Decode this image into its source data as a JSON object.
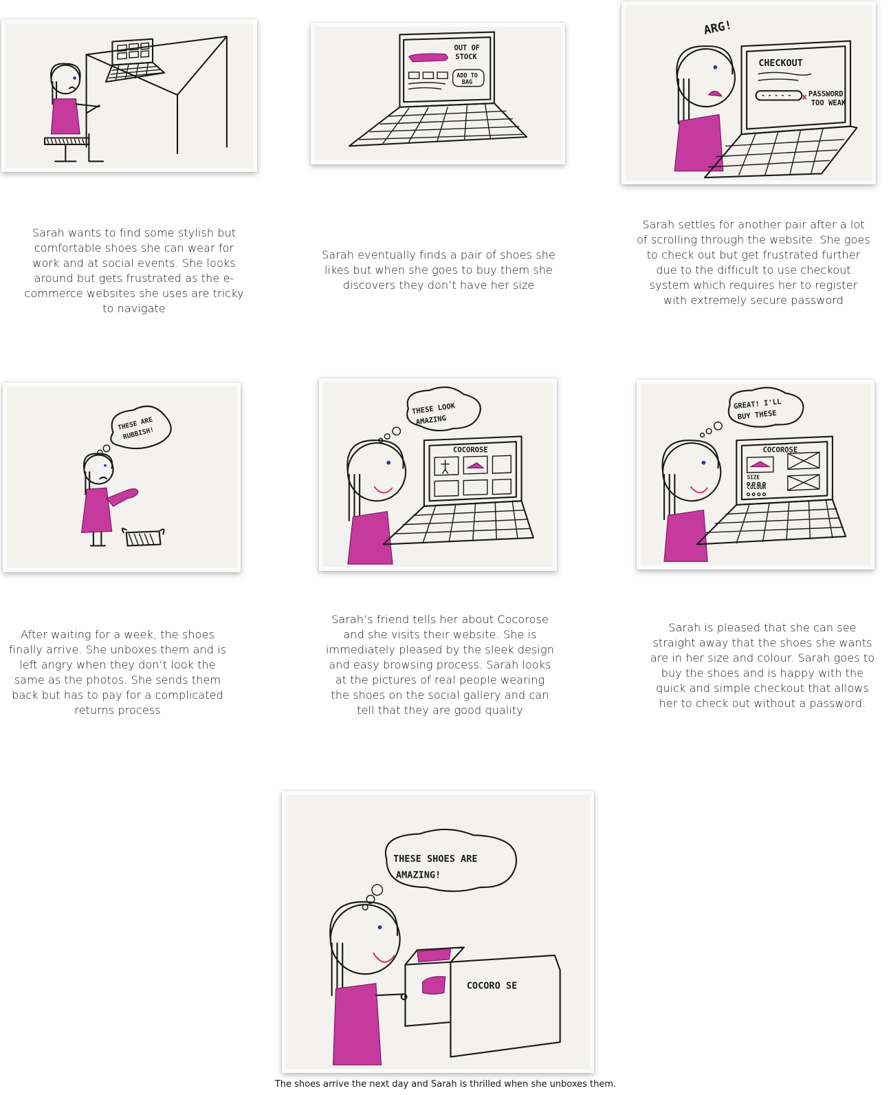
{
  "panels": [
    {
      "caption": "Sarah wants to find some stylish but comfortable shoes she can wear for work and at social events. She looks around but gets frustrated as the e-commerce websites she uses are tricky to navigate"
    },
    {
      "caption": "Sarah eventually finds a pair of shoes she likes but when she goes to buy them she discovers they don’t have her size",
      "screen_text": [
        "OUT OF",
        "STOCK",
        "ADD TO",
        "BAG"
      ]
    },
    {
      "caption": "Sarah settles for another pair after a lot of scrolling through the website. She goes to check out but get frustrated further due to the difficult to use checkout system which requires her to register with extremely secure password",
      "exclaim": "ARG!",
      "screen_title": "CHECKOUT",
      "error_text": [
        "PASSWORD",
        "TOO WEAK"
      ]
    },
    {
      "caption": "After waiting for a week, the shoes finally arrive. She unboxes them and is left angry when they don’t look the same as the photos. She sends them back but has to pay for a complicated returns process",
      "thought": [
        "THESE ARE",
        "RUBBISH!"
      ]
    },
    {
      "caption": "Sarah’s friend tells her about Cocorose and she visits their website. She is immediately pleased by the sleek design and easy browsing process. Sarah looks at the pictures of real people wearing the shoes on the social gallery and can tell that they are good quality",
      "thought": [
        "THESE LOOK",
        "AMAZING"
      ],
      "screen_title": "COCOROSE"
    },
    {
      "caption": "Sarah is pleased that she can see straight away that the shoes she wants are in her size and colour. Sarah goes to buy the shoes and is happy with the quick and simple checkout that allows her to check out without a password.",
      "thought": [
        "GREAT! I'LL",
        "BUY THESE"
      ],
      "screen_title": "COCOROSE",
      "options": [
        "SIZE",
        "COLOUR"
      ]
    },
    {
      "caption": "The shoes arrive the next day and Sarah is thrilled when she unboxes them.",
      "thought": [
        "THESE SHOES ARE",
        "AMAZING!"
      ],
      "box_label": "COCORO SE"
    }
  ],
  "colors": {
    "dress": "#d24aa8",
    "ink": "#1a1a1a",
    "paper": "#f3f2ef"
  }
}
